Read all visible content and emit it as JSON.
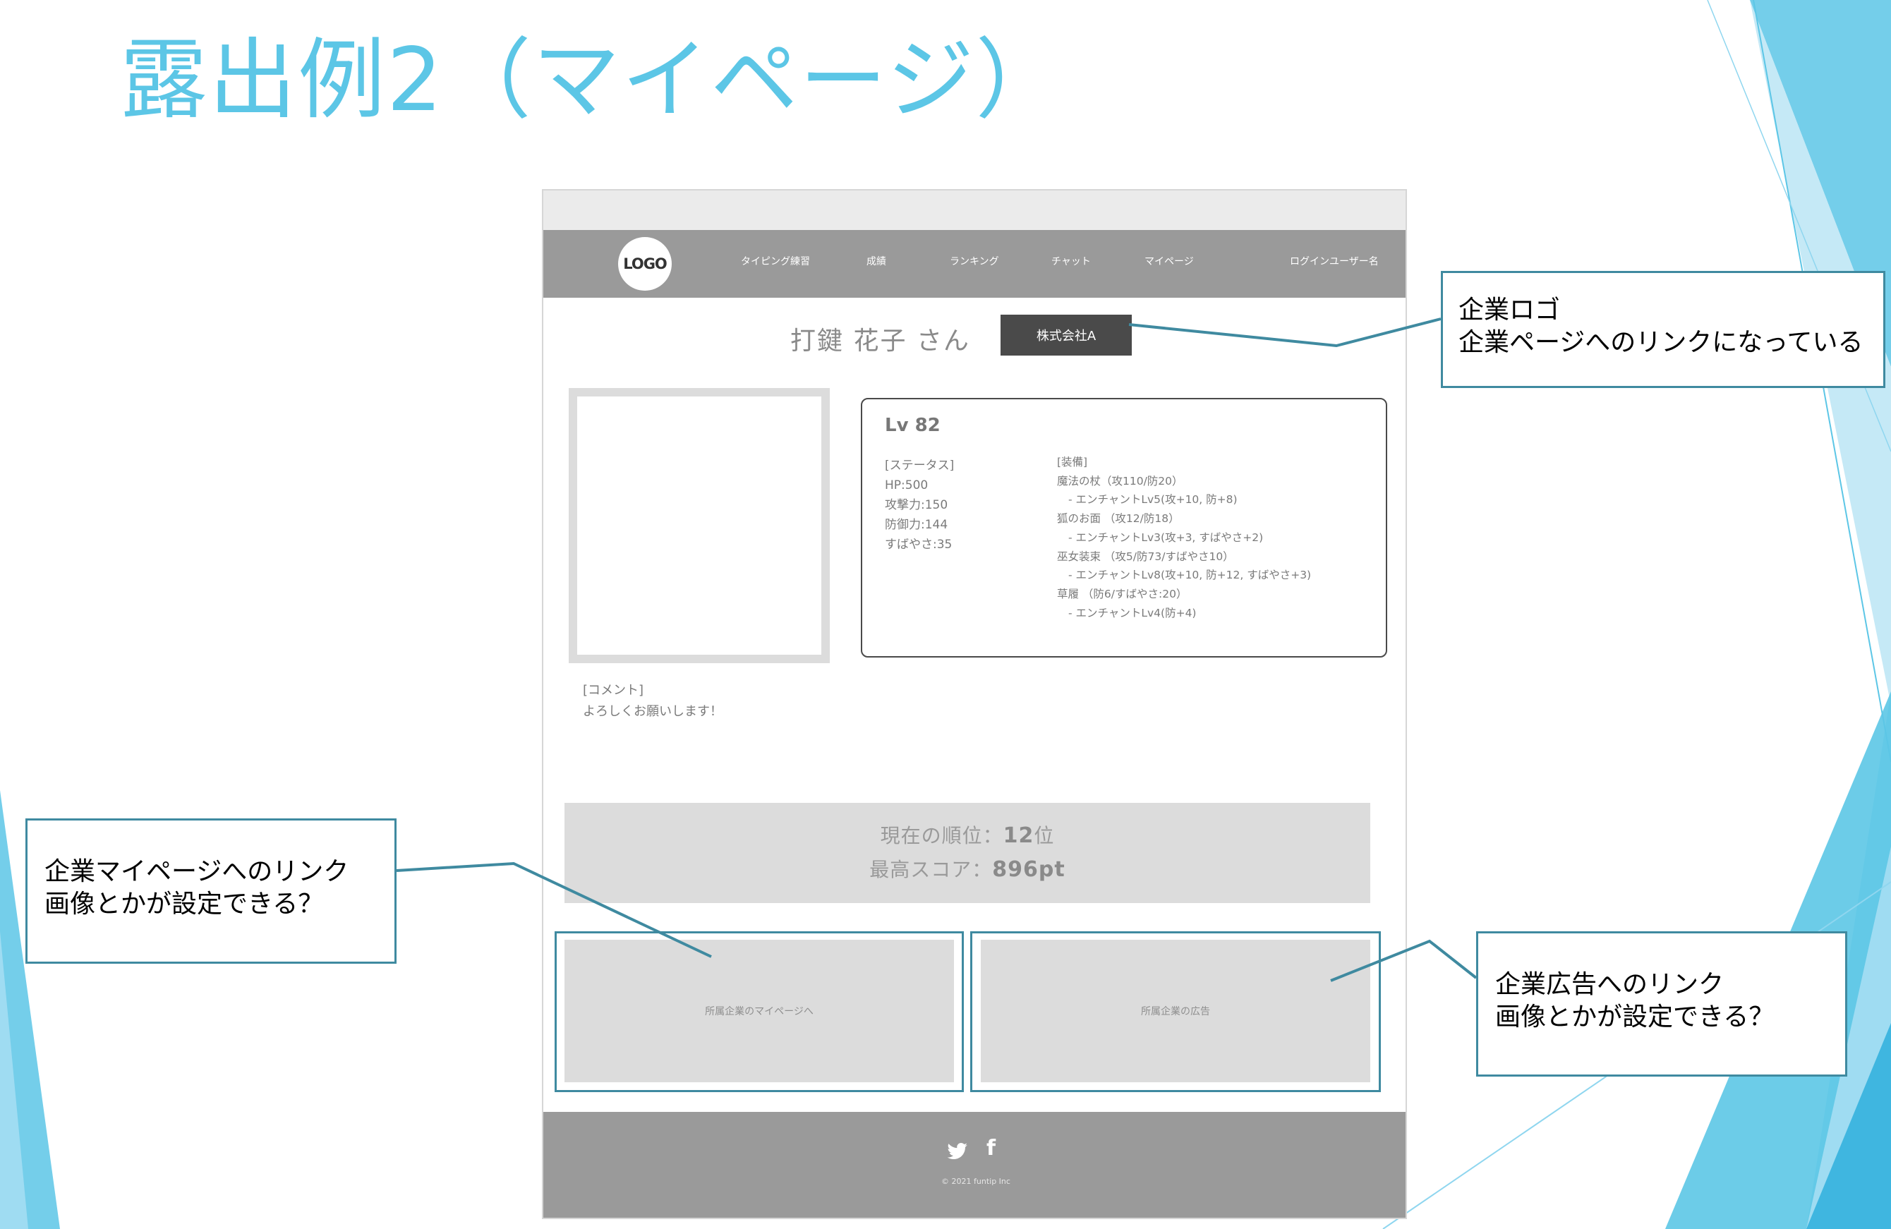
{
  "slide": {
    "title": "露出例2（マイページ）"
  },
  "mock": {
    "logo_text": "LOGO",
    "nav": [
      "タイピング練習",
      "成績",
      "ランキング",
      "チャット",
      "マイページ"
    ],
    "login_user": "ログインユーザー名",
    "user_name": "打鍵 花子 さん",
    "company_button": "株式会社A",
    "level": "Lv 82",
    "status": {
      "heading": "[ステータス]",
      "lines": [
        "HP:500",
        "攻撃力:150",
        "防御力:144",
        "すばやさ:35"
      ]
    },
    "equipment": {
      "heading": "[装備]",
      "lines": [
        "魔法の杖（攻110/防20）",
        "- エンチャントLv5(攻+10, 防+8)",
        "狐のお面 （攻12/防18）",
        "- エンチャントLv3(攻+3, すばやさ+2)",
        "巫女装束 （攻5/防73/すばやさ10）",
        "- エンチャントLv8(攻+10, 防+12, すばやさ+3)",
        "草履 （防6/すばやさ:20）",
        "- エンチャントLv4(防+4)"
      ]
    },
    "comment": {
      "heading": "[コメント]",
      "text": "よろしくお願いします！"
    },
    "ranking": {
      "rank_label": "現在の順位：",
      "rank_value": "12",
      "rank_unit": "位",
      "score_label": "最高スコア：",
      "score_value": "896pt"
    },
    "banner_mypage": "所属企業のマイページへ",
    "banner_ad": "所属企業の広告",
    "social": {
      "twitter_icon": "twitter-icon",
      "facebook_icon": "facebook-icon",
      "facebook_glyph": "f"
    },
    "copyright": "© 2021 funtip Inc"
  },
  "callouts": {
    "logo": [
      "企業ロゴ",
      "企業ページへのリンクになっている"
    ],
    "mypage": [
      "企業マイページへのリンク",
      "画像とかが設定できる？"
    ],
    "ad": [
      "企業広告へのリンク",
      "画像とかが設定できる？"
    ]
  },
  "colors": {
    "title": "#5cc6e6",
    "callout_border": "#3f8aa0",
    "nav_gray": "#9a9a9a",
    "company_button": "#4a4a4a"
  }
}
